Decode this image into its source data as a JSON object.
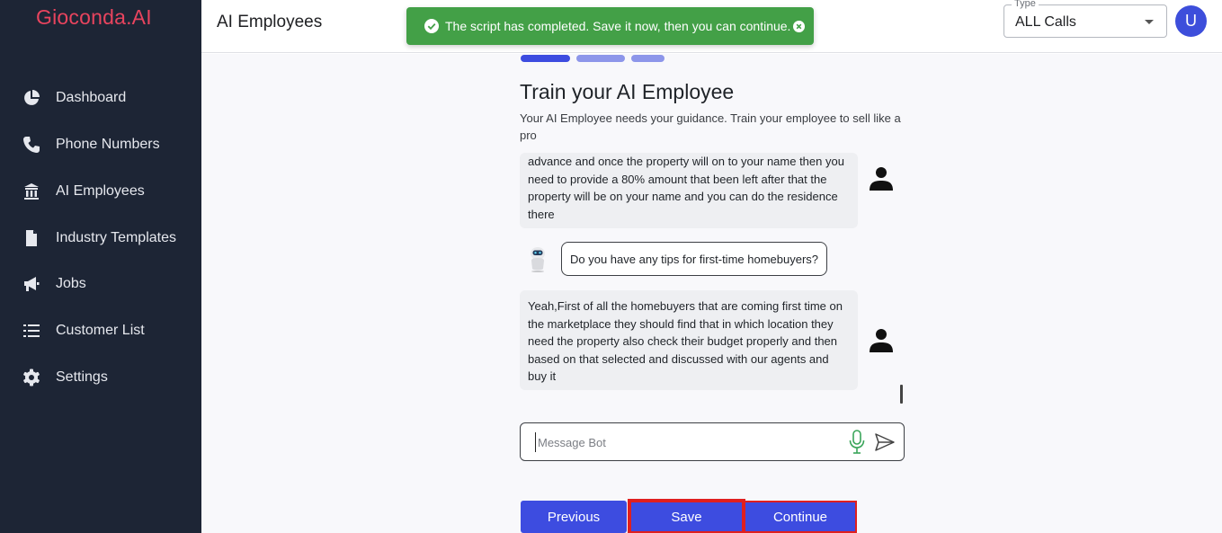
{
  "brand": {
    "name_main": "Gioconda",
    "name_suffix": ".AI"
  },
  "sidebar": {
    "items": [
      {
        "label": "Dashboard",
        "icon": "pie-chart-icon"
      },
      {
        "label": "Phone Numbers",
        "icon": "phone-icon"
      },
      {
        "label": "AI Employees",
        "icon": "building-icon"
      },
      {
        "label": "Industry Templates",
        "icon": "file-icon"
      },
      {
        "label": "Jobs",
        "icon": "megaphone-icon"
      },
      {
        "label": "Customer List",
        "icon": "list-icon"
      },
      {
        "label": "Settings",
        "icon": "gear-icon"
      }
    ]
  },
  "header": {
    "title": "AI Employees",
    "type_select": {
      "legend": "Type",
      "value": "ALL Calls"
    },
    "avatar_initial": "U"
  },
  "toast": {
    "message": "The script has completed. Save it now, then you can continue.",
    "color": "#43a047"
  },
  "stepper": {
    "steps": 3,
    "current": 1
  },
  "train": {
    "heading": "Train your AI Employee",
    "subtext": "Your AI Employee needs your guidance. Train your employee to sell like a pro"
  },
  "chat": {
    "messages": [
      {
        "role": "user",
        "text": "advance and once the property will on to your name then you need to provide a 80% amount that been left after that the property will be on your name and you can do the residence there"
      },
      {
        "role": "bot",
        "text": "Do you have any tips for first-time homebuyers?"
      },
      {
        "role": "user",
        "text": "Yeah,First of all the homebuyers that are coming first time on the marketplace they should find that in which location they need the property also check their budget properly and then based on that selected and discussed with our agents and buy it"
      }
    ],
    "input_placeholder": "Message Bot",
    "input_value": ""
  },
  "buttons": {
    "previous": "Previous",
    "save": "Save",
    "continue": "Continue"
  },
  "colors": {
    "sidebar_bg": "#1d2535",
    "brand": "#e8445e",
    "primary": "#3d4ce0",
    "highlight_border": "#e01f1f",
    "mic": "#3aa55a"
  }
}
